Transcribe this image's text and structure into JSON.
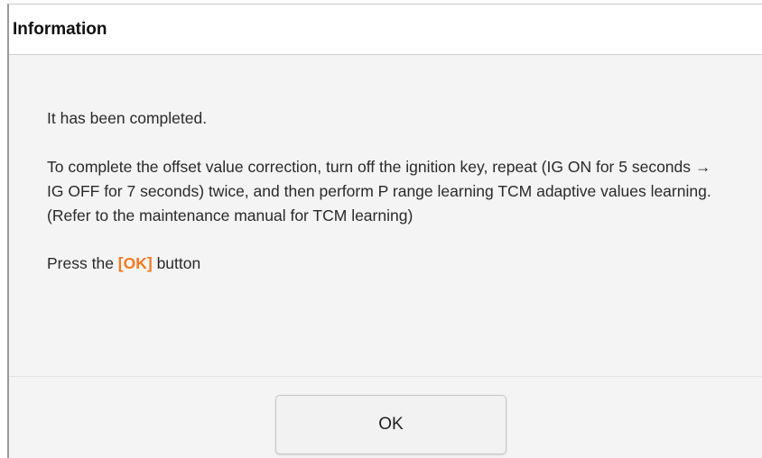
{
  "dialog": {
    "title": "Information",
    "line_completed": "It has been completed.",
    "instructions": "To complete the offset value correction, turn off the ignition key, repeat (IG ON for 5 seconds → IG OFF for 7 seconds) twice, and then perform P range learning TCM adaptive values learning. (Refer to the maintenance manual for TCM learning)",
    "press_prefix": "Press the ",
    "press_ok": "[OK]",
    "press_suffix": " button",
    "ok_button_label": "OK"
  },
  "colors": {
    "accent": "#f47a20"
  }
}
